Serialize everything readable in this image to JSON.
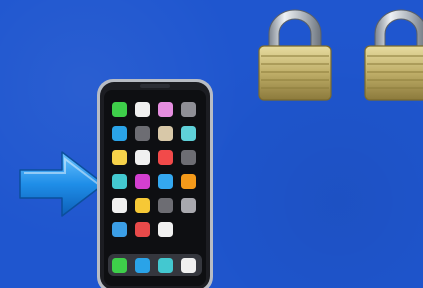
{
  "scene": {
    "background_color": "#1f56cf",
    "icons": [
      {
        "name": "right-arrow-icon",
        "color": "#1e8fe8"
      },
      {
        "name": "mobile-phone-icon",
        "color": "#222831"
      },
      {
        "name": "locked-padlock-icon",
        "color": "#b9a768"
      },
      {
        "name": "locked-padlock-icon",
        "color": "#b9a768"
      }
    ],
    "phone_app_colors": [
      [
        "#3ecf4a",
        "#f0f0f0",
        "#e68ee0",
        "#8f8f96"
      ],
      [
        "#2aa3e8",
        "#6d6d73",
        "#d8c8a8",
        "#5fd0d8"
      ],
      [
        "#f6d24a",
        "#f0f0f0",
        "#f24a4a",
        "#6d6d73"
      ],
      [
        "#43c8d0",
        "#d33fd0",
        "#34a8f0",
        "#f59a1a"
      ],
      [
        "#f0f0f0",
        "#f6c836",
        "#6d6d73",
        "#a8a8ae"
      ],
      [
        "#3b9ee6",
        "#e84a4a",
        "#f0f0f0",
        null
      ]
    ],
    "phone_dock_colors": [
      "#3ecf4a",
      "#2aa3e8",
      "#43c8d0",
      "#f0f0f0"
    ]
  }
}
